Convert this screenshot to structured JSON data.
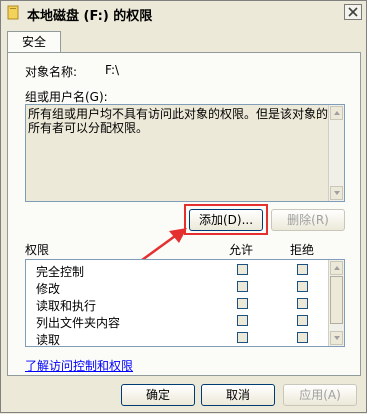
{
  "window": {
    "title": "本地磁盘 (F:) 的权限",
    "close_glyph": "✕"
  },
  "tabs": [
    {
      "label": "安全"
    }
  ],
  "object_name": {
    "label": "对象名称:",
    "value": "F:\\"
  },
  "group_users": {
    "label": "组或用户名(G):",
    "message": "所有组或用户均不具有访问此对象的权限。但是该对象的所有者可以分配权限。"
  },
  "buttons": {
    "add": "添加(D)...",
    "remove": "删除(R)"
  },
  "permissions": {
    "label": "权限",
    "allow_header": "允许",
    "deny_header": "拒绝",
    "items": [
      {
        "name": "完全控制"
      },
      {
        "name": "修改"
      },
      {
        "name": "读取和执行"
      },
      {
        "name": "列出文件夹内容"
      },
      {
        "name": "读取"
      }
    ]
  },
  "link": "了解访问控制和权限",
  "footer": {
    "ok": "确定",
    "cancel": "取消",
    "apply": "应用(A)"
  },
  "colors": {
    "highlight": "#e53030",
    "link": "#0000ff"
  }
}
